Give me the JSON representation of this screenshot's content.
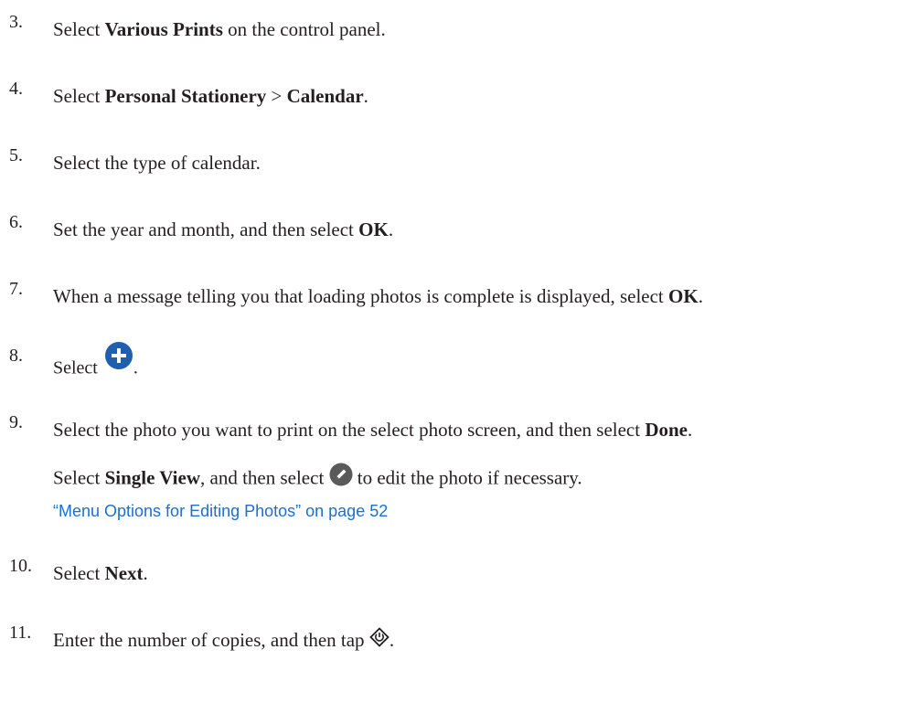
{
  "steps": [
    {
      "num": "3.",
      "parts": [
        "Select ",
        "Various Prints",
        " on the control panel."
      ]
    },
    {
      "num": "4.",
      "parts": [
        "Select ",
        "Personal Stationery",
        " > ",
        "Calendar",
        "."
      ]
    },
    {
      "num": "5.",
      "parts": [
        "Select the type of calendar."
      ]
    },
    {
      "num": "6.",
      "parts": [
        "Set the year and month, and then select ",
        "OK",
        "."
      ]
    },
    {
      "num": "7.",
      "parts": [
        "When a message telling you that loading photos is complete is displayed, select ",
        "OK",
        "."
      ]
    },
    {
      "num": "8.",
      "parts": [
        "Select ",
        "."
      ]
    },
    {
      "num": "9.",
      "parts": [
        "Select the photo you want to print on the select photo screen, and then select ",
        "Done",
        "."
      ]
    },
    {
      "num": "10.",
      "parts": [
        "Select ",
        "Next",
        "."
      ]
    },
    {
      "num": "11.",
      "parts": [
        "Enter the number of copies, and then tap ",
        "."
      ]
    }
  ],
  "note": {
    "parts": [
      "Select ",
      "Single View",
      ", and then select ",
      " to edit the photo if necessary."
    ]
  },
  "link_text": "“Menu Options for Editing Photos” on page 52",
  "icons": {
    "add": "plus-circle-icon",
    "edit": "pencil-circle-icon",
    "start": "start-diamond-icon"
  },
  "colors": {
    "text": "#231f20",
    "link": "#1c6fd1",
    "icon_blue": "#1f5fae",
    "icon_gray": "#5a5a5a"
  }
}
